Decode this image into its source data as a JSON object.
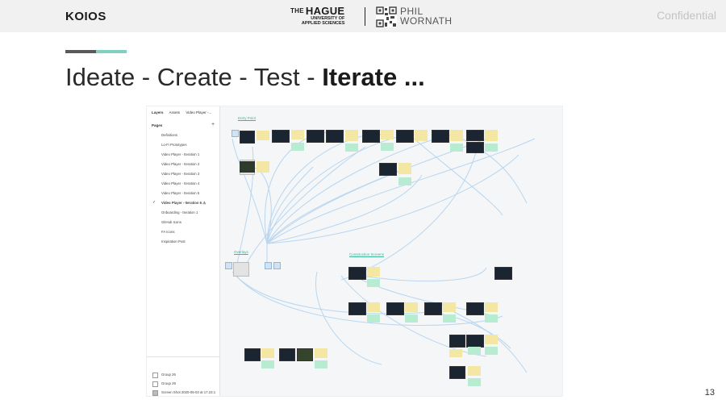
{
  "header": {
    "brand": "KOIOS",
    "confidential": "Confidential",
    "hague_the": "THE",
    "hague_name": "HAGUE",
    "hague_sub1": "UNIVERSITY OF",
    "hague_sub2": "APPLIED SCIENCES",
    "pw_line1": "PHIL",
    "pw_line2": "WORNATH"
  },
  "slide": {
    "title_plain": "Ideate - Create - Test - ",
    "title_bold": "Iterate ...",
    "page_number": "13"
  },
  "figma": {
    "tabs": [
      "Layers",
      "Assets",
      "Video Player -..."
    ],
    "pages_heading": "Pages",
    "pages": [
      "Definitions",
      "Lo-Fi Prototypes",
      "Video Player - Iteration 1",
      "Video Player - Iteration 2",
      "Video Player - Iteration 3",
      "Video Player - Iteration 4",
      "Video Player - Iteration 5",
      "Video Player - Iteration 6 ⚠",
      "Onboarding - Iteration 1",
      "GitHub Icons",
      "FA Icons",
      "Inspiration Post"
    ],
    "current_page_index": 7,
    "layers": [
      "Group 26",
      "Group 29",
      "Screen Shot 2020-05-03 at 17.23.1"
    ],
    "canvas_labels": [
      "Entry Point",
      "Overlays",
      "Construction Screens"
    ]
  }
}
